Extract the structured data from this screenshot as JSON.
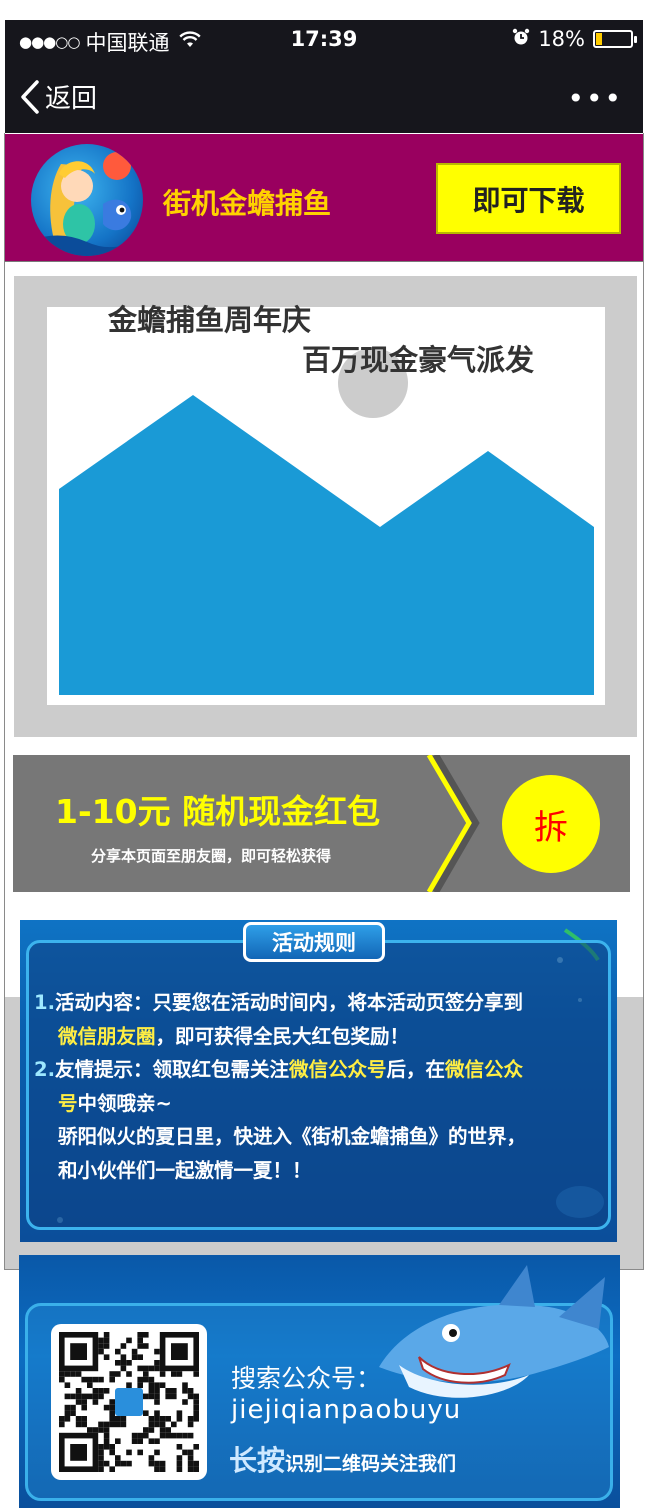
{
  "status_bar": {
    "signal": "●●●○○",
    "carrier": "中国联通",
    "time": "17:39",
    "battery_percent": "18%",
    "battery_level": 0.18
  },
  "nav": {
    "back_label": "返回",
    "more_label": "•••"
  },
  "app_banner": {
    "name": "街机金蟾捕鱼",
    "download_label": "即可下载"
  },
  "hero": {
    "title_line1": "金蟾捕鱼周年庆",
    "title_line2": "百万现金豪气派发"
  },
  "red_packet": {
    "title": "1-10元 随机现金红包",
    "subtitle": "分享本页面至朋友圈，即可轻松获得",
    "open_label": "拆"
  },
  "rules": {
    "header": "活动规则",
    "item1_num": "1.",
    "item1_text_a": "活动内容：只要您在活动时间内，将本活动页签分享到",
    "item1_text_b_hl": "微信朋友圈",
    "item1_text_b": "，即可获得全民大红包奖励！",
    "item2_num": "2.",
    "item2_text_a": "友情提示：领取红包需关注",
    "item2_hl1": "微信公众号",
    "item2_text_b": "后，在",
    "item2_hl2": "微信公众",
    "item2_hl3": "号",
    "item2_text_c": "中领哦亲~",
    "line3": "骄阳似火的夏日里，快进入《街机金蟾捕鱼》的世界，",
    "line4": "和小伙伴们一起激情一夏！！"
  },
  "follow": {
    "search_label": "搜索公众号：",
    "account_id": "jiejiqianpaobuyu",
    "longpress_big": "长按",
    "longpress_small": "识别二维码关注我们"
  },
  "colors": {
    "banner_bg": "#99005f",
    "app_name": "#ffd200",
    "download_bg": "#ffff00",
    "packet_bg": "#777777",
    "packet_title": "#ffff00",
    "open_button_bg": "#ffff00",
    "open_button_text": "#ff0000",
    "placeholder_mountain": "#1a9ad6"
  }
}
